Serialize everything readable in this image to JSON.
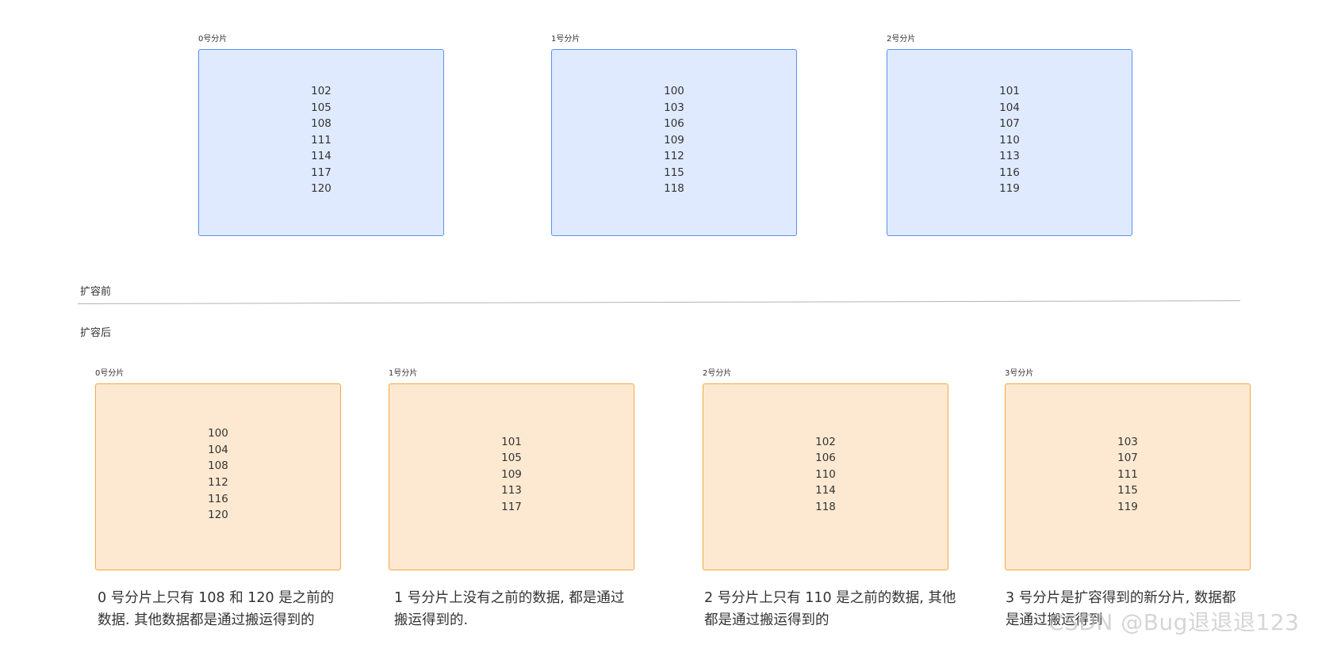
{
  "sections": {
    "before_label": "扩容前",
    "after_label": "扩容后"
  },
  "colors": {
    "before_fill": "#e0eaff",
    "before_border": "#5b8ff0",
    "after_fill": "#fde9d2",
    "after_border": "#f5a742",
    "divider": "#b3b3b3"
  },
  "before": [
    {
      "label": "0号分片",
      "values": [
        "102",
        "105",
        "108",
        "111",
        "114",
        "117",
        "120"
      ]
    },
    {
      "label": "1号分片",
      "values": [
        "100",
        "103",
        "106",
        "109",
        "112",
        "115",
        "118"
      ]
    },
    {
      "label": "2号分片",
      "values": [
        "101",
        "104",
        "107",
        "110",
        "113",
        "116",
        "119"
      ]
    }
  ],
  "after": [
    {
      "label": "0号分片",
      "values": [
        "100",
        "104",
        "108",
        "112",
        "116",
        "120"
      ]
    },
    {
      "label": "1号分片",
      "values": [
        "101",
        "105",
        "109",
        "113",
        "117"
      ]
    },
    {
      "label": "2号分片",
      "values": [
        "102",
        "106",
        "110",
        "114",
        "118"
      ]
    },
    {
      "label": "3号分片",
      "values": [
        "103",
        "107",
        "111",
        "115",
        "119"
      ]
    }
  ],
  "notes": [
    {
      "line1": "0 号分片上只有 108 和 120 是之前的",
      "line2": "数据. 其他数据都是通过搬运得到的"
    },
    {
      "line1": "1 号分片上没有之前的数据, 都是通过",
      "line2": "搬运得到的."
    },
    {
      "line1": "2 号分片上只有 110 是之前的数据, 其他",
      "line2": "都是通过搬运得到的"
    },
    {
      "line1": "3 号分片是扩容得到的新分片, 数据都",
      "line2": "是通过搬运得到"
    }
  ],
  "watermark": "CSDN @Bug退退退123"
}
